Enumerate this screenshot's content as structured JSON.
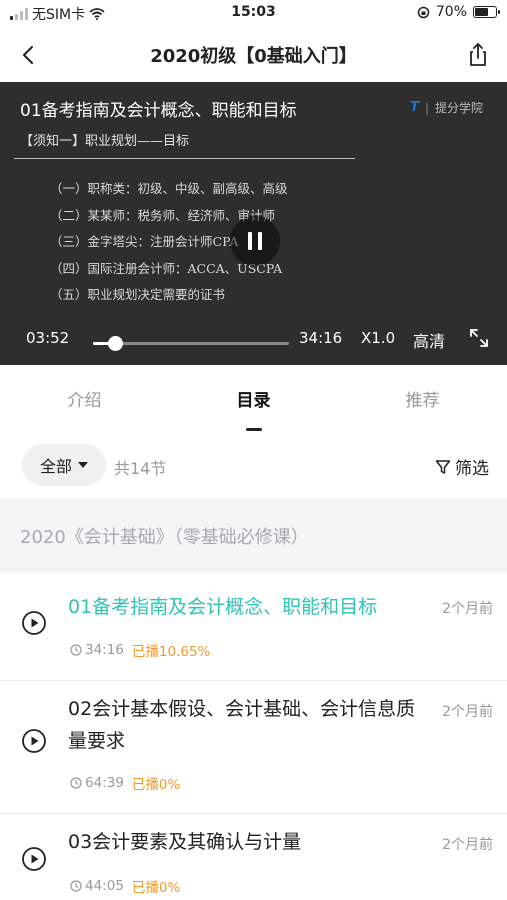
{
  "status_bar": {
    "carrier": "无SIM卡",
    "time": "15:03",
    "battery_text": "70%",
    "battery_level": 0.7
  },
  "nav": {
    "title": "2020初级【0基础入门】"
  },
  "video": {
    "title": "01备考指南及会计概念、职能和目标",
    "brand": "提分学院",
    "brand_mark": "T",
    "subtitle": "【须知一】职业规划——目标",
    "lines": [
      "（一）职称类：初级、中级、副高级、高级",
      "（二）某某师：税务师、经济师、审计师",
      "（三）金字塔尖：注册会计师CPA",
      "（四）国际注册会计师：ACCA、USCPA",
      "（五）职业规划决定需要的证书"
    ],
    "current_time": "03:52",
    "duration": "34:16",
    "progress": 0.113,
    "speed": "X1.0",
    "quality": "高清"
  },
  "tabs": [
    {
      "label": "介绍",
      "active": false
    },
    {
      "label": "目录",
      "active": true
    },
    {
      "label": "推荐",
      "active": false
    }
  ],
  "filter": {
    "all_label": "全部",
    "count_label": "共14节",
    "filter_label": "筛选"
  },
  "section": {
    "title": "2020《会计基础》（零基础必修课）"
  },
  "lessons": [
    {
      "title": "01备考指南及会计概念、职能和目标",
      "ago": "2个月前",
      "duration": "34:16",
      "progress": "已播10.65%",
      "current": true
    },
    {
      "title": "02会计基本假设、会计基础、会计信息质量要求",
      "ago": "2个月前",
      "duration": "64:39",
      "progress": "已播0%",
      "current": false
    },
    {
      "title": "03会计要素及其确认与计量",
      "ago": "2个月前",
      "duration": "44:05",
      "progress": "已播0%",
      "current": false
    }
  ]
}
